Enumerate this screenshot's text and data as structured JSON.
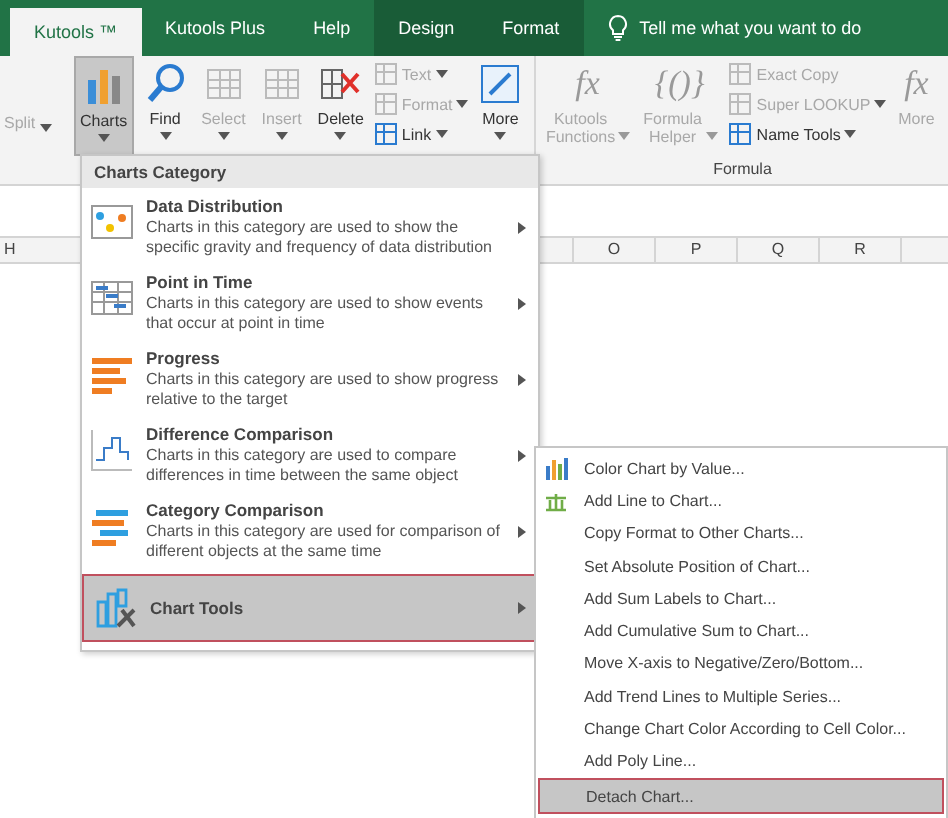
{
  "tabs": [
    {
      "label": "Kutools ™",
      "selected": true,
      "contextual": false
    },
    {
      "label": "Kutools Plus",
      "selected": false,
      "contextual": false
    },
    {
      "label": "Help",
      "selected": false,
      "contextual": false
    },
    {
      "label": "Design",
      "selected": false,
      "contextual": true
    },
    {
      "label": "Format",
      "selected": false,
      "contextual": true
    }
  ],
  "tell_me": {
    "placeholder": "Tell me what you want to do"
  },
  "ribbon": {
    "groups": [
      {
        "items": [
          {
            "kind": "large",
            "label": "Split",
            "disabled": true,
            "selected": false,
            "dropdown": true
          },
          {
            "kind": "large",
            "label": "Charts",
            "disabled": false,
            "selected": true,
            "dropdown": true
          },
          {
            "kind": "large",
            "label": "Find",
            "disabled": false,
            "selected": false,
            "dropdown": true
          },
          {
            "kind": "large",
            "label": "Select",
            "disabled": true,
            "selected": false,
            "dropdown": true
          },
          {
            "kind": "large",
            "label": "Insert",
            "disabled": true,
            "selected": false,
            "dropdown": true
          },
          {
            "kind": "large",
            "label": "Delete",
            "disabled": false,
            "selected": false,
            "dropdown": true
          },
          {
            "kind": "stack",
            "entries": [
              {
                "label": "Text",
                "disabled": true,
                "dropdown": true
              },
              {
                "label": "Format",
                "disabled": true,
                "dropdown": true
              },
              {
                "label": "Link",
                "disabled": false,
                "dropdown": true
              }
            ]
          },
          {
            "kind": "large",
            "label": "More",
            "disabled": false,
            "selected": false,
            "dropdown": true
          }
        ]
      },
      {
        "label": "Formula",
        "items": [
          {
            "kind": "large",
            "label": "Kutools Functions",
            "glyph": "fx",
            "disabled": true,
            "selected": false,
            "dropdown": true
          },
          {
            "kind": "large",
            "label": "Formula Helper",
            "glyph": "{()}",
            "disabled": true,
            "selected": false,
            "dropdown": true
          },
          {
            "kind": "stack",
            "entries": [
              {
                "label": "Exact Copy",
                "disabled": true,
                "dropdown": false
              },
              {
                "label": "Super LOOKUP",
                "disabled": true,
                "dropdown": true
              },
              {
                "label": "Name Tools",
                "disabled": false,
                "dropdown": true
              }
            ]
          },
          {
            "kind": "large",
            "label": "More",
            "glyph": "fx",
            "disabled": true,
            "selected": false,
            "dropdown": false
          }
        ]
      }
    ]
  },
  "columns": [
    "H",
    "O",
    "P",
    "Q",
    "R"
  ],
  "charts_menu": {
    "header": "Charts Category",
    "items": [
      {
        "title": "Data Distribution",
        "description": "Charts in this category are used to show the specific gravity and frequency of data distribution",
        "selected": false,
        "submenu": true
      },
      {
        "title": "Point in Time",
        "description": "Charts in this category are used to show events that occur at point in time",
        "selected": false,
        "submenu": true
      },
      {
        "title": "Progress",
        "description": "Charts in this category are used to show progress relative to the target",
        "selected": false,
        "submenu": true
      },
      {
        "title": "Difference Comparison",
        "description": "Charts in this category are used to compare differences in time between the same object",
        "selected": false,
        "submenu": true
      },
      {
        "title": "Category Comparison",
        "description": "Charts in this category are used for comparison of different objects at the same time",
        "selected": false,
        "submenu": true
      },
      {
        "title": "Chart Tools",
        "selected": true,
        "submenu": true
      }
    ]
  },
  "chart_tools_menu": {
    "items": [
      {
        "label": "Color Chart by Value...",
        "selected": false
      },
      {
        "label": "Add Line to Chart...",
        "selected": false
      },
      {
        "label": "Copy Format to Other Charts...",
        "selected": false
      },
      {
        "label": "Set Absolute Position of Chart...",
        "selected": false
      },
      {
        "label": "Add Sum Labels to Chart...",
        "selected": false
      },
      {
        "label": "Add Cumulative Sum to Chart...",
        "selected": false
      },
      {
        "label": "Move X-axis to Negative/Zero/Bottom...",
        "selected": false
      },
      {
        "label": "Add Trend Lines to Multiple Series...",
        "selected": false
      },
      {
        "label": "Change Chart Color According to Cell Color...",
        "selected": false
      },
      {
        "label": "Add Poly Line...",
        "selected": false
      },
      {
        "label": "Detach Chart...",
        "selected": true
      }
    ]
  }
}
